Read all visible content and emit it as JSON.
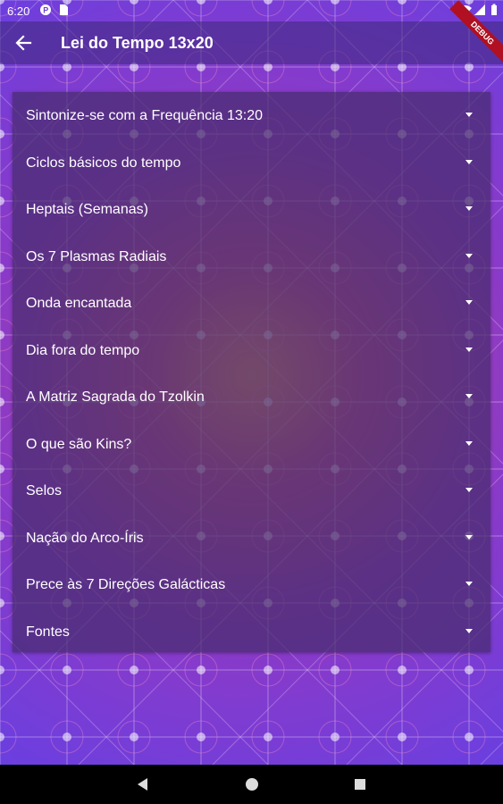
{
  "status_bar": {
    "time": "6:20",
    "left_icons": [
      "p-icon",
      "sim-icon"
    ],
    "right_icons": [
      "wifi-icon",
      "signal-icon",
      "battery-icon"
    ]
  },
  "app_bar": {
    "title": "Lei do Tempo 13x20",
    "back_icon": "arrow-back-icon",
    "debug_banner": "DEBUG"
  },
  "accordion": {
    "items": [
      {
        "label": "Sintonize-se com a Frequência 13:20"
      },
      {
        "label": "Ciclos básicos do tempo"
      },
      {
        "label": "Heptais (Semanas)"
      },
      {
        "label": "Os 7 Plasmas Radiais"
      },
      {
        "label": "Onda encantada"
      },
      {
        "label": "Dia fora do tempo"
      },
      {
        "label": "A Matriz Sagrada do Tzolkin"
      },
      {
        "label": "O que são Kins?"
      },
      {
        "label": "Selos"
      },
      {
        "label": "Nação do Arco-Íris"
      },
      {
        "label": "Prece às 7 Direções Galácticas"
      },
      {
        "label": "Fontes"
      }
    ]
  },
  "nav_bar": {
    "buttons": [
      "back-triangle-icon",
      "home-circle-icon",
      "recents-square-icon"
    ]
  },
  "colors": {
    "panel": "#462d6e",
    "background_purple": "#6a3fe0",
    "background_glow": "#ffd23c",
    "navbar": "#000000",
    "debug_banner": "#b01022"
  }
}
